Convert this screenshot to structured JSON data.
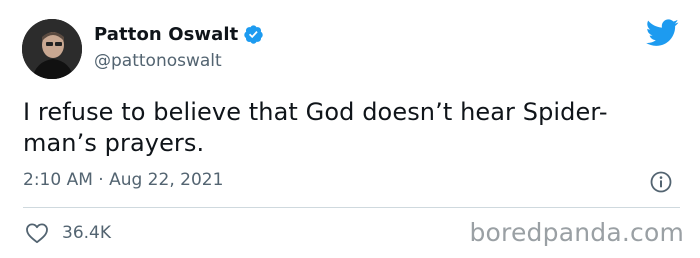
{
  "author": {
    "display_name": "Patton Oswalt",
    "handle": "@pattonoswalt",
    "verified": true
  },
  "tweet": {
    "text_line1": "I refuse to believe that God doesn’t hear Spider-",
    "text_line2": "man’s prayers.",
    "timestamp": "2:10 AM · Aug 22, 2021"
  },
  "engagement": {
    "likes": "36.4K"
  },
  "watermark": "boredpanda.com",
  "colors": {
    "brand_blue": "#1d9bf0",
    "text_primary": "#0f1419",
    "text_secondary": "#536471"
  },
  "icons": [
    "verified-badge-icon",
    "twitter-bird-icon",
    "info-icon",
    "heart-icon"
  ]
}
